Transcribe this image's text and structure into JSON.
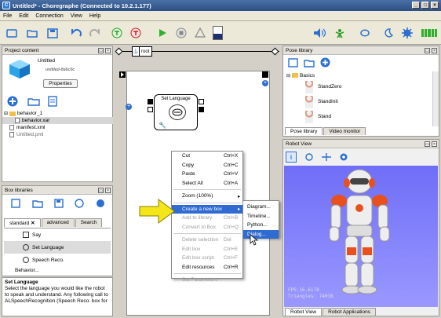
{
  "window": {
    "title": "Untitled* - Choregraphe (Connected to 10.2.1.177)",
    "app_icon": "C"
  },
  "menubar": [
    "File",
    "Edit",
    "Connection",
    "View",
    "Help"
  ],
  "project": {
    "panel_title": "Project content",
    "name": "Untitled",
    "id": "untitled-8a6c6c",
    "properties_label": "Properties",
    "tree": [
      "behavior_1",
      "behavior.xar",
      "manifest.xml",
      "Untitled.pml"
    ]
  },
  "box_libraries": {
    "panel_title": "Box libraries",
    "tabs": [
      "standard",
      "advanced",
      "Search"
    ],
    "items": [
      "Say",
      "Set Language",
      "Speech Reco.",
      "Behavior..."
    ],
    "desc_title": "Set Language",
    "desc_text": "Select the language you would like the robot to speak and understand. Any following call to ALSpeechRecognition (Speech Reco. box for"
  },
  "flow": {
    "root_label": "root",
    "box_label": "Set Language"
  },
  "context_menu": [
    {
      "label": "Cut",
      "shortcut": "Ctrl+X",
      "disabled": false
    },
    {
      "label": "Copy",
      "shortcut": "Ctrl+C",
      "disabled": false
    },
    {
      "label": "Paste",
      "shortcut": "Ctrl+V",
      "disabled": false
    },
    {
      "label": "Select All",
      "shortcut": "Ctrl+A",
      "disabled": false
    },
    {
      "label": "Zoom (100%)",
      "shortcut": "",
      "disabled": false
    },
    {
      "label": "Create a new box",
      "shortcut": "",
      "disabled": false
    },
    {
      "label": "Add to library",
      "shortcut": "Ctrl+B",
      "disabled": true
    },
    {
      "label": "Convert to Box",
      "shortcut": "Ctrl+Q",
      "disabled": true
    },
    {
      "label": "Delete selection",
      "shortcut": "Del",
      "disabled": true
    },
    {
      "label": "Edit box",
      "shortcut": "Ctrl+E",
      "disabled": true
    },
    {
      "label": "Edit box script",
      "shortcut": "Ctrl+F",
      "disabled": true
    },
    {
      "label": "Edit resources",
      "shortcut": "Ctrl+R",
      "disabled": false
    },
    {
      "label": "Set Parameters",
      "shortcut": "",
      "disabled": true
    }
  ],
  "submenu": [
    "Diagram...",
    "Timeline...",
    "Python...",
    "Dialog..."
  ],
  "pose_library": {
    "panel_title": "Pose library",
    "group": "Basics",
    "poses": [
      "StandZero",
      "StandInit",
      "Stand"
    ],
    "tabs": [
      "Pose library",
      "Video monitor"
    ]
  },
  "robot_view": {
    "panel_title": "Robot View",
    "fps": "FPS:16.6178",
    "triangles": "Triangles: 74038",
    "tabs": [
      "Robot View",
      "Robot Applications"
    ]
  },
  "colors": {
    "accent": "#2f6bd0",
    "arrow": "#f5e61a",
    "robot_orange": "#e8501e",
    "viewport": "#7a78ff"
  }
}
